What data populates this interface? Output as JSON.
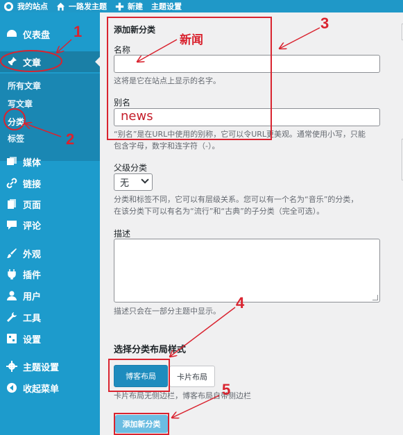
{
  "adminbar": {
    "site_name": "我的站点",
    "theme_link": "一路发主题",
    "new_label": "新建",
    "theme_settings": "主题设置"
  },
  "sidebar": {
    "dashboard": "仪表盘",
    "posts": "文章",
    "sub": {
      "all_posts": "所有文章",
      "write": "写文章",
      "categories": "分类",
      "tags": "标签"
    },
    "media": "媒体",
    "links": "链接",
    "pages": "页面",
    "comments": "评论",
    "appearance": "外观",
    "plugins": "插件",
    "users": "用户",
    "tools": "工具",
    "settings": "设置",
    "theme_settings": "主题设置",
    "collapse": "收起菜单"
  },
  "form": {
    "title": "添加新分类",
    "name_label": "名称",
    "name_value": "",
    "name_help": "这将是它在站点上显示的名字。",
    "slug_label": "别名",
    "slug_value": "news",
    "slug_help_1": "“别名”是在URL中使用的别称，它可以令URL更美观。通常使用小写，只能",
    "slug_help_2": "包含字母，数字和连字符（-）。",
    "parent_label": "父级分类",
    "parent_value": "无",
    "parent_help_1": "分类和标签不同，它可以有层级关系。您可以有一个名为“音乐”的分类，",
    "parent_help_2": "在该分类下可以有名为“流行”和“古典”的子分类（完全可选）。",
    "desc_label": "描述",
    "desc_help": "描述只会在一部分主题中显示。",
    "layout_title": "选择分类布局样式",
    "blog_layout": "博客布局",
    "card_layout": "卡片布局",
    "layout_help": "卡片布局无侧边栏，博客布局自带侧边栏",
    "submit": "添加新分类"
  },
  "annotations": {
    "n1": "1",
    "n2": "2",
    "n3": "3",
    "n4": "4",
    "n5": "5",
    "name_hint": "新闻"
  },
  "colors": {
    "admin_blue": "#1d9bcc",
    "annotation_red": "#d9232f",
    "primary_button": "#1e8cbe"
  }
}
